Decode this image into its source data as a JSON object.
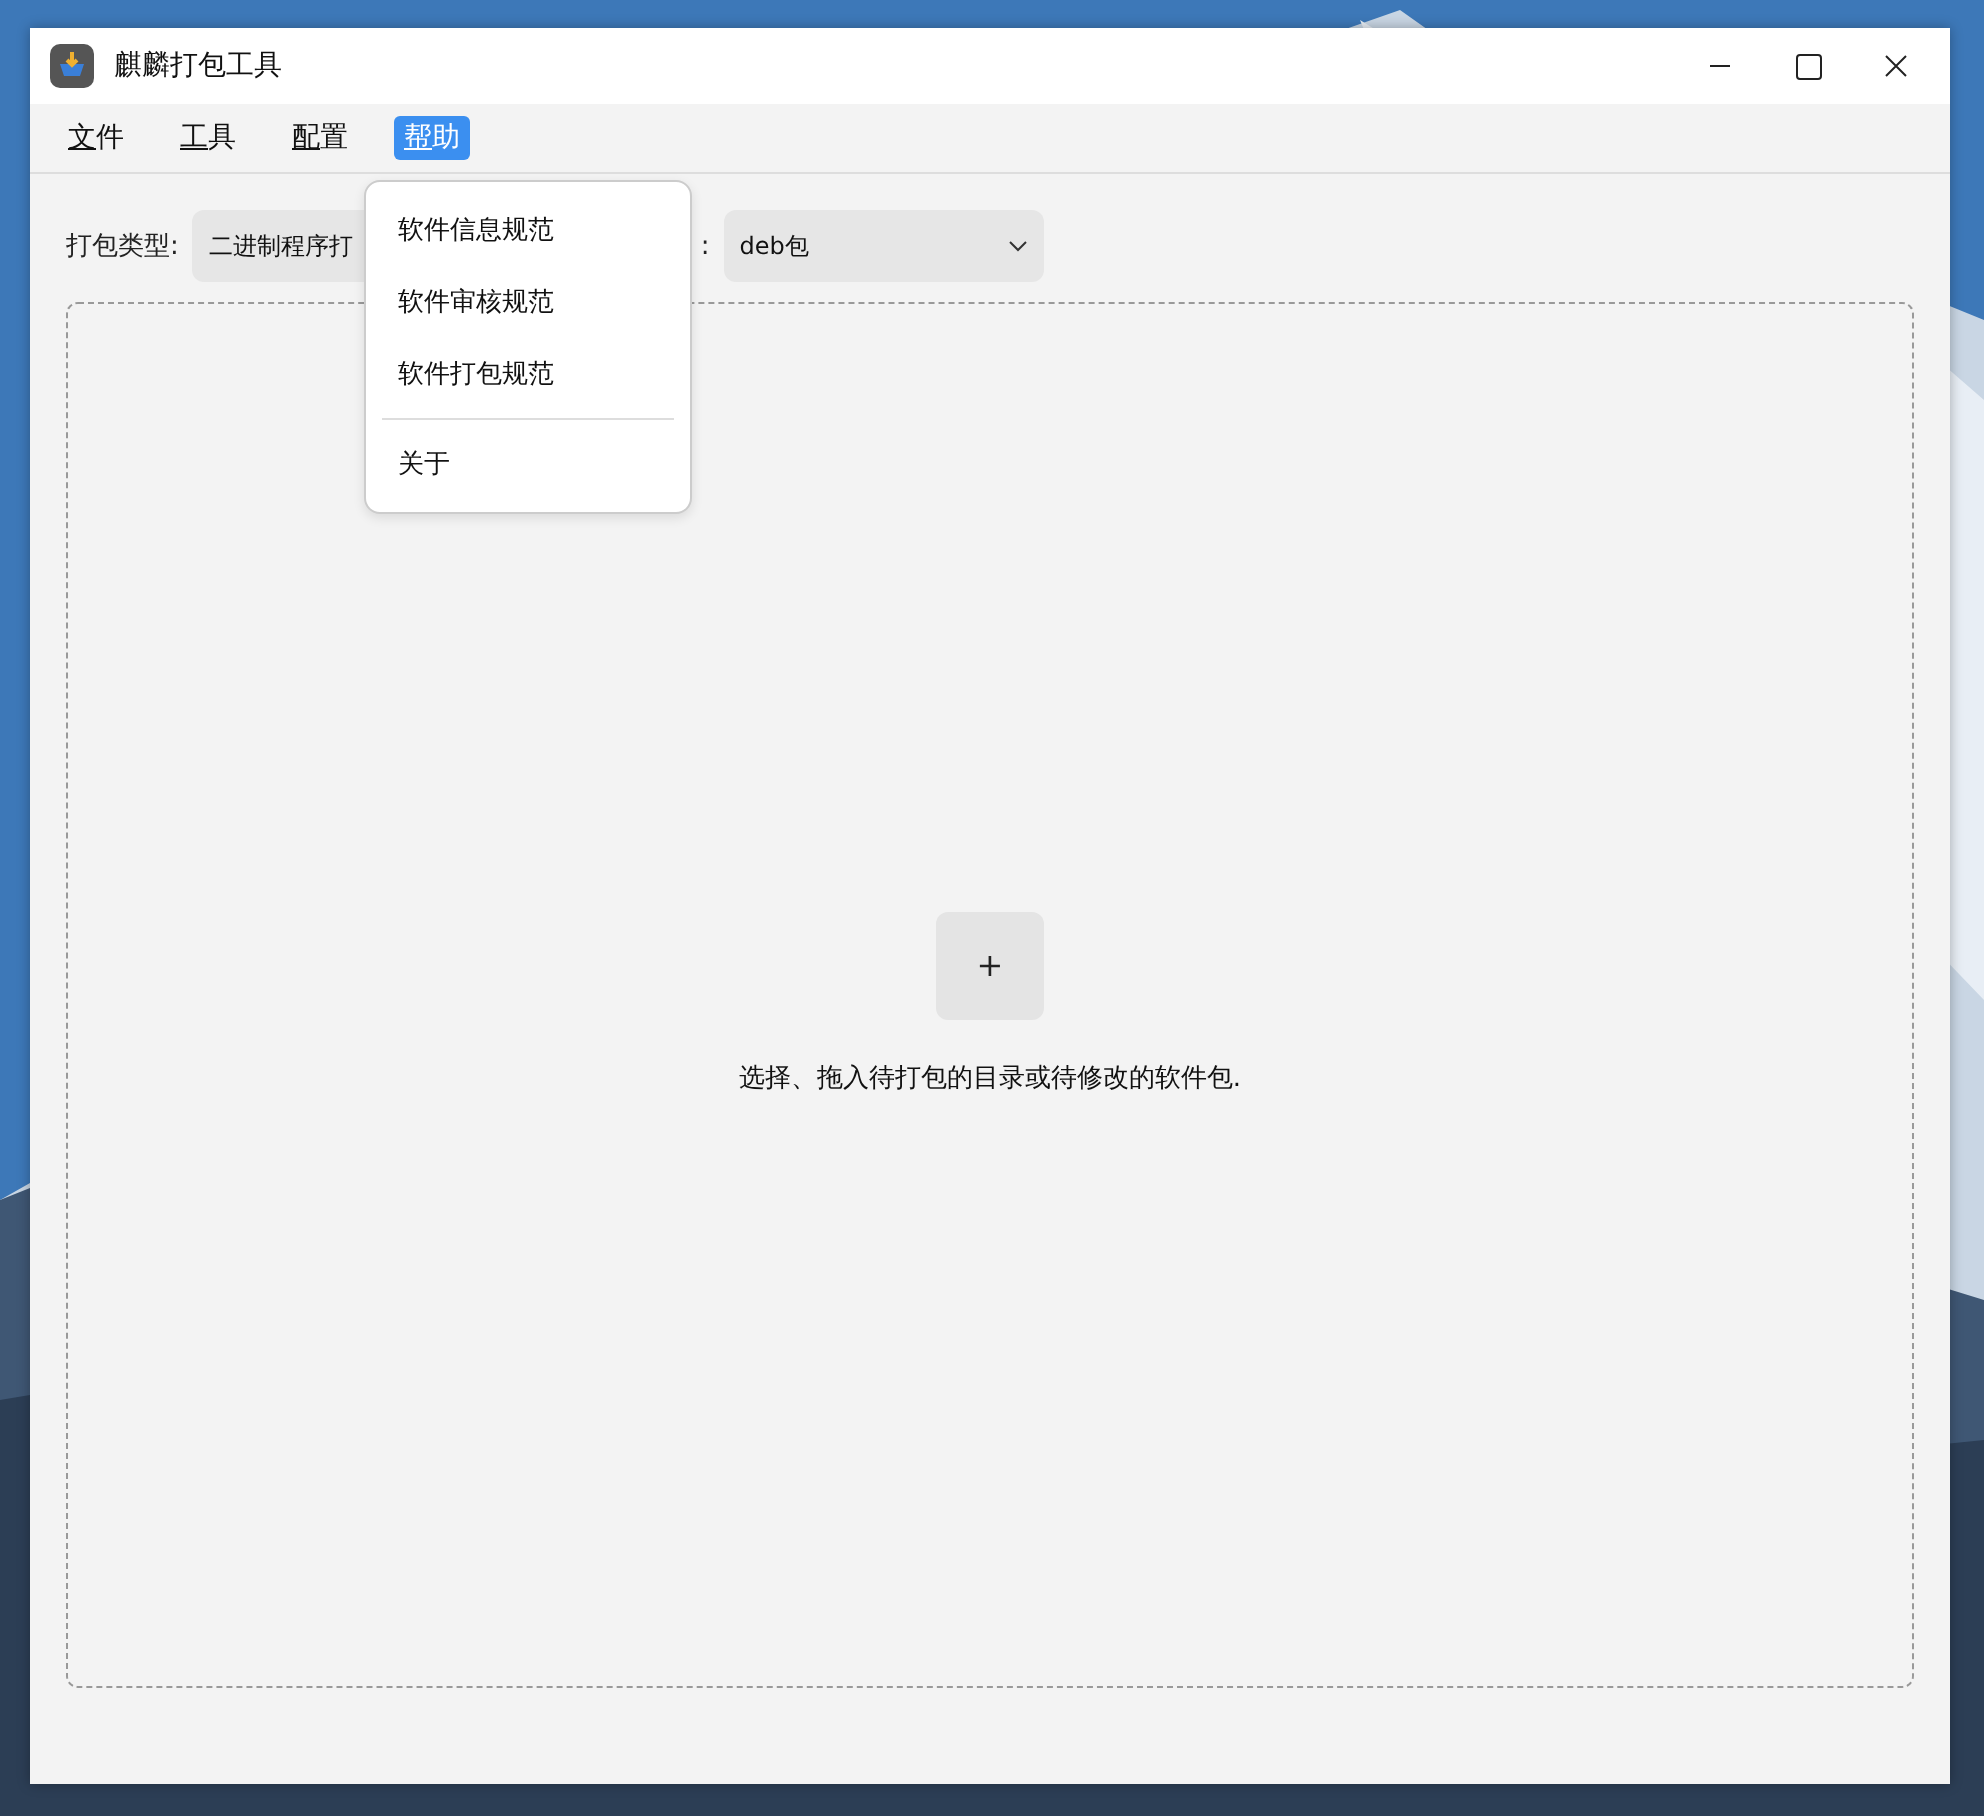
{
  "window": {
    "title": "麒麟打包工具"
  },
  "menu_bar": [
    {
      "label": "文件",
      "selected": false
    },
    {
      "label": "工具",
      "selected": false
    },
    {
      "label": "配置",
      "selected": false
    },
    {
      "label": "帮助",
      "selected": true
    }
  ],
  "help_menu": {
    "items": [
      {
        "label": "软件信息规范",
        "kind": "item"
      },
      {
        "label": "软件审核规范",
        "kind": "item"
      },
      {
        "label": "软件打包规范",
        "kind": "item"
      },
      {
        "kind": "separator"
      },
      {
        "label": "关于",
        "kind": "item"
      }
    ]
  },
  "package_type": {
    "label": "打包类型:",
    "value": "二进制程序打"
  },
  "package_format": {
    "label": ":",
    "value": "deb包"
  },
  "drop_area": {
    "button": "+",
    "hint": "选择、拖入待打包的目录或待修改的软件包."
  }
}
